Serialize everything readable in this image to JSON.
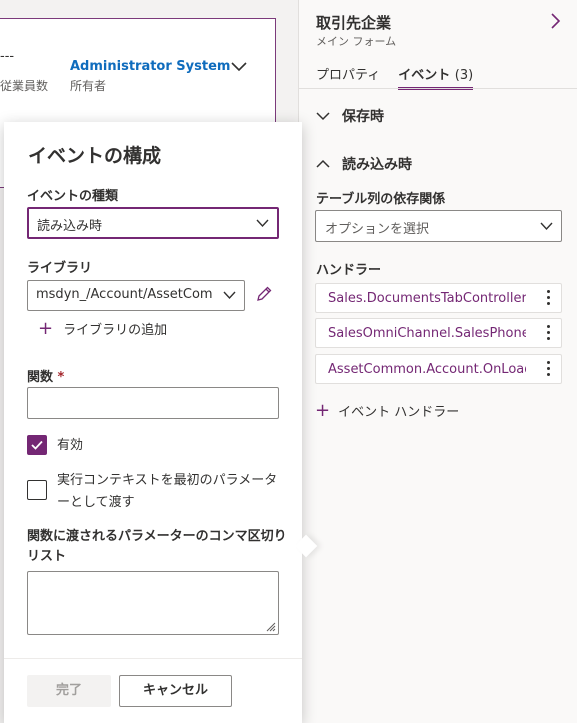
{
  "background_form": {
    "dashes": "---",
    "employees_label": "従業員数",
    "owner_name": "Administrator System",
    "owner_label": "所有者"
  },
  "pane": {
    "title": "取引先企業",
    "subtitle": "メイン フォーム",
    "tabs": [
      {
        "label": "プロパティ",
        "active": false
      },
      {
        "label": "イベント",
        "count": "(3)",
        "active": true
      }
    ],
    "sections": [
      {
        "label": "保存時",
        "expanded": false
      },
      {
        "label": "読み込み時",
        "expanded": true
      }
    ],
    "dependency_label": "テーブル列の依存関係",
    "dependency_placeholder": "オプションを選択",
    "handlers_label": "ハンドラー",
    "handlers": [
      "Sales.DocumentsTabController.s",
      "SalesOmniChannel.SalesPhoneN",
      "AssetCommon.Account.OnLoad"
    ],
    "add_handler_label": "イベント ハンドラー"
  },
  "dialog": {
    "title": "イベントの構成",
    "event_type_label": "イベントの種類",
    "event_type_value": "読み込み時",
    "library_label": "ライブラリ",
    "library_value": "msdyn_/Account/AssetCom...",
    "add_library_label": "ライブラリの追加",
    "function_label": "関数",
    "required_mark": "*",
    "function_value": "",
    "enabled_label": "有効",
    "enabled_checked": true,
    "pass_context_label": "実行コンテキストを最初のパラメーターとして渡す",
    "pass_context_checked": false,
    "params_label": "関数に渡されるパラメーターのコンマ区切りリスト",
    "params_value": "",
    "done_label": "完了",
    "cancel_label": "キャンセル"
  },
  "colors": {
    "accent": "#742774",
    "link": "#0f6cbd",
    "required": "#a4262c"
  }
}
